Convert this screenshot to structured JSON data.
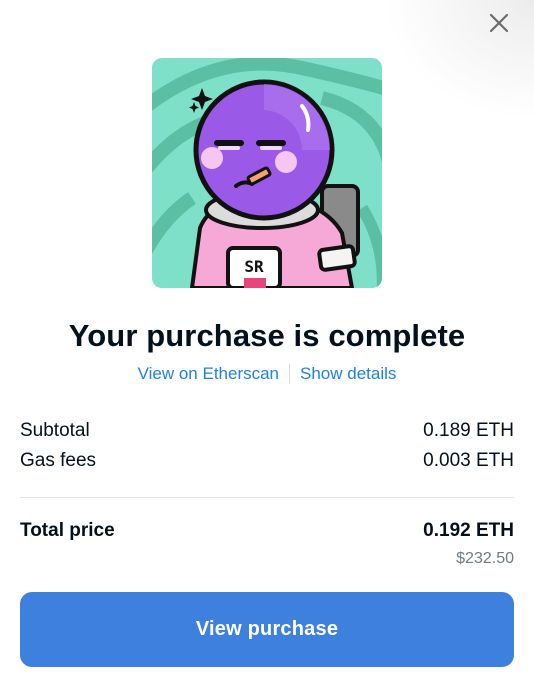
{
  "modal": {
    "close_icon": "close-icon",
    "nft_image_alt": "",
    "nft_badge_text": "SR",
    "title": "Your purchase is complete",
    "links": {
      "etherscan": "View on Etherscan",
      "details": "Show details"
    },
    "summary": {
      "subtotal_label": "Subtotal",
      "subtotal_value": "0.189 ETH",
      "gas_label": "Gas fees",
      "gas_value": "0.003 ETH",
      "total_label": "Total price",
      "total_value": "0.192 ETH",
      "total_usd": "$232.50"
    },
    "button_label": "View purchase"
  },
  "colors": {
    "accent": "#2081e2",
    "button": "#3e80de",
    "text": "#04111d",
    "muted": "#707a83"
  }
}
